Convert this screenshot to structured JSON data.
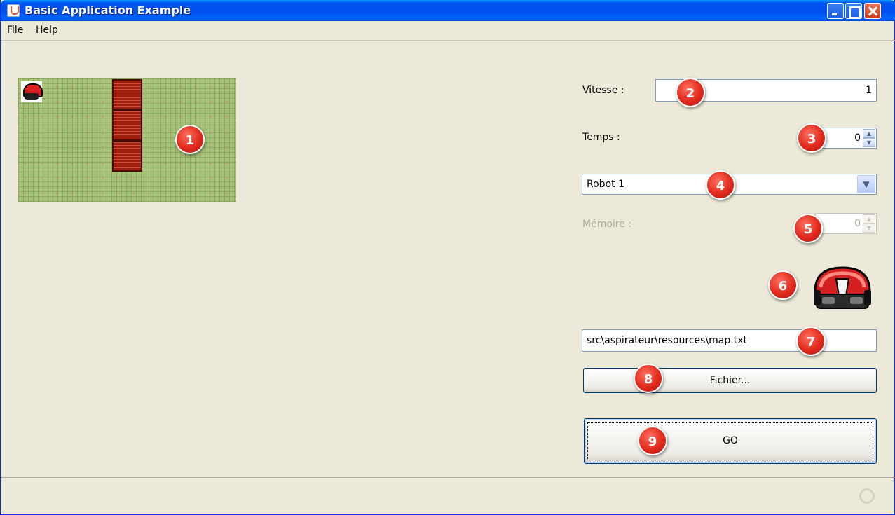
{
  "window": {
    "title": "Basic Application Example"
  },
  "menu": {
    "file": "File",
    "help": "Help"
  },
  "controls": {
    "vitesse_label": "Vitesse :",
    "vitesse_value": "1",
    "temps_label": "Temps :",
    "temps_value": "0",
    "robot_selected": "Robot 1",
    "memoire_label": "Mémoire :",
    "memoire_value": "0",
    "file_path": "src\\aspirateur\\resources\\map.txt",
    "fichier_button": "Fichier...",
    "go_button": "GO"
  },
  "badges": [
    "1",
    "2",
    "3",
    "4",
    "5",
    "6",
    "7",
    "8",
    "9"
  ],
  "icons": {
    "robot": "robot-vacuum-icon",
    "crate": "wooden-crate-icon",
    "busy": "busy-indicator-icon"
  },
  "colors": {
    "titlebar": "#0053ee",
    "badge": "#e02a1c",
    "window_bg": "#ece9d8"
  }
}
